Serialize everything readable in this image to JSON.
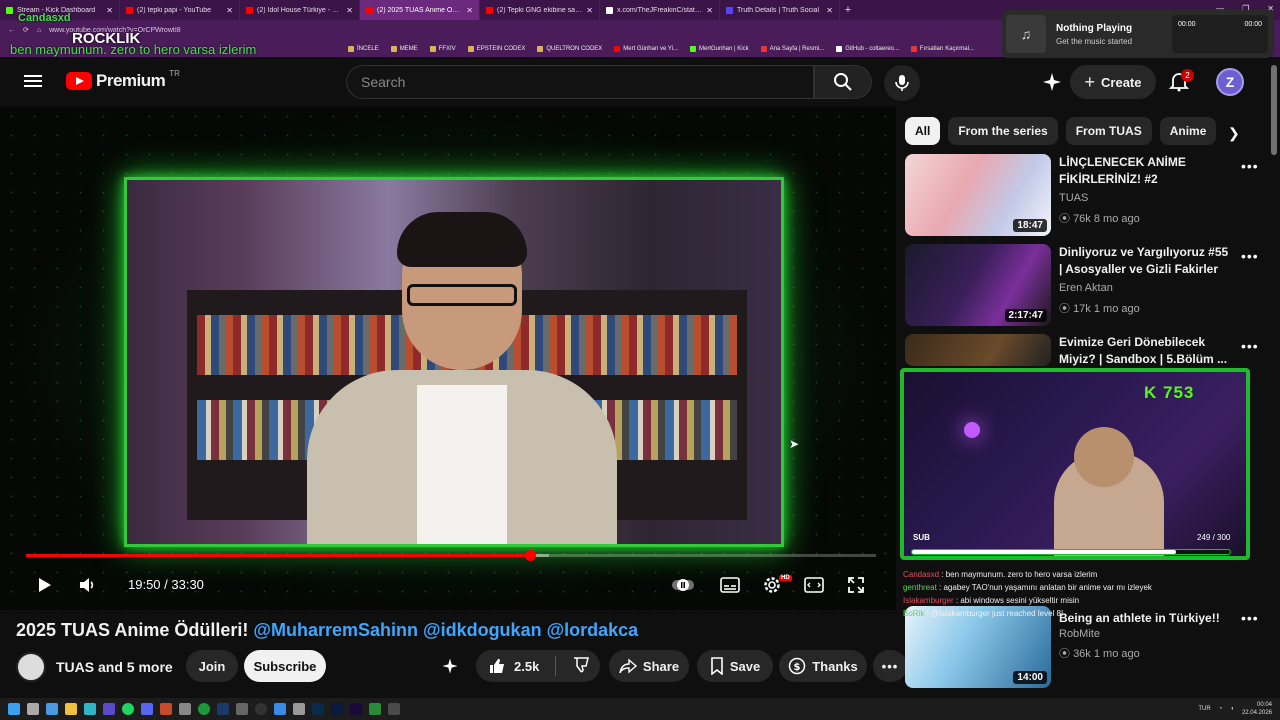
{
  "browser": {
    "tabs": [
      {
        "title": "Stream - Kick Dashboard",
        "color": "#53fc18"
      },
      {
        "title": "(2) tepki papi - YouTube",
        "color": "#ff0000"
      },
      {
        "title": "(2) Idol House Türkiye - YouTube",
        "color": "#ff0000"
      },
      {
        "title": "(2) 2025 TUAS Anime Ödülleri! @",
        "color": "#ff0000",
        "active": true
      },
      {
        "title": "(2) Tepki GNG ekibine saplıyor anı",
        "color": "#ff0000"
      },
      {
        "title": "x.com/TheJFreakinC/status/2046",
        "color": "#ffffff"
      },
      {
        "title": "Truth Details | Truth Social",
        "color": "#5448ee"
      }
    ],
    "url": "www.youtube.com/watch?v=OrCPWrowtI8",
    "bookmarks": [
      "İNCELE",
      "MEME",
      "FFXIV",
      "EPSTEIN CODEX",
      "QUELTRON CODEX",
      "Mert Günhan ve Yi...",
      "MertGunhan | Kick",
      "Ana Sayfa | Resmi...",
      "GitHub - coltaereo...",
      "Fırsatları Kaçırmal..."
    ]
  },
  "overlay": {
    "streamer": "Candasxd",
    "brand": "ROCKLIK",
    "chat_line": "ben maymunum. zero to hero varsa izlerim"
  },
  "media": {
    "title": "Nothing Playing",
    "subtitle": "Get the music started",
    "time_left": "00:00",
    "time_right": "00:00"
  },
  "header": {
    "brand": "Premium",
    "region": "TR",
    "search_placeholder": "Search",
    "create_label": "Create",
    "notif_count": "2",
    "avatar_letter": "Z"
  },
  "player": {
    "current_time": "19:50",
    "duration": "33:30",
    "time_display": "19:50 / 33:30",
    "played_fraction": 0.5925,
    "loaded_fraction": 0.615,
    "hd_badge": "HD"
  },
  "video": {
    "title_main": "2025 TUAS Anime Ödülleri!",
    "tags": [
      "@MuharremSahinn",
      "@idkdogukan",
      "@lordakca"
    ],
    "channel": "TUAS and 5 more",
    "join_label": "Join",
    "subscribe_label": "Subscribe",
    "likes": "2.5k",
    "share_label": "Share",
    "save_label": "Save",
    "thanks_label": "Thanks"
  },
  "chips": [
    "All",
    "From the series",
    "From TUAS",
    "Anime"
  ],
  "recommendations": [
    {
      "title": "LİNÇLENECEK ANİME FİKİRLERİNİZ! #2",
      "channel": "TUAS",
      "views": "76k",
      "age": "8 mo ago",
      "meta": "76k  8 mo ago",
      "duration": "18:47"
    },
    {
      "title": "Dinliyoruz ve Yargılıyoruz #55 | Asosyaller ve Gizli Fakirler",
      "channel": "Eren Aktan",
      "views": "17k",
      "age": "1 mo ago",
      "meta": "17k  1 mo ago",
      "duration": "2:17:47"
    },
    {
      "title": "Evimize Geri Dönebilecek Miyiz? | Sandbox | 5.Bölüm ...",
      "channel": "",
      "views": "",
      "age": "",
      "meta": "",
      "duration": ""
    },
    {
      "title": "Being an athlete in Türkiye!!",
      "channel": "RobMite",
      "views": "36k",
      "age": "1 mo ago",
      "meta": "36k  1 mo ago",
      "duration": "14:00"
    }
  ],
  "stream_widget": {
    "kick_count": "K 753",
    "sub_label": "SUB",
    "sub_count": "249 / 300",
    "sub_progress": 0.83
  },
  "kick_chat": [
    {
      "user": "Candasxd",
      "msg": "ben maymunum. zero to hero varsa izlerim"
    },
    {
      "user": "genthreat",
      "msg": "agabey TAO'nun yaşamını anlatan bir anime var mı izleyek"
    },
    {
      "user": "Islakamburger",
      "msg": "abi windows sesini yükseltir misin"
    },
    {
      "user": "BoRik",
      "msg": "@Islakamburger just reached level 8!"
    }
  ],
  "taskbar": {
    "lang": "TUR",
    "time": "00:04",
    "date": "22.04.2026"
  }
}
